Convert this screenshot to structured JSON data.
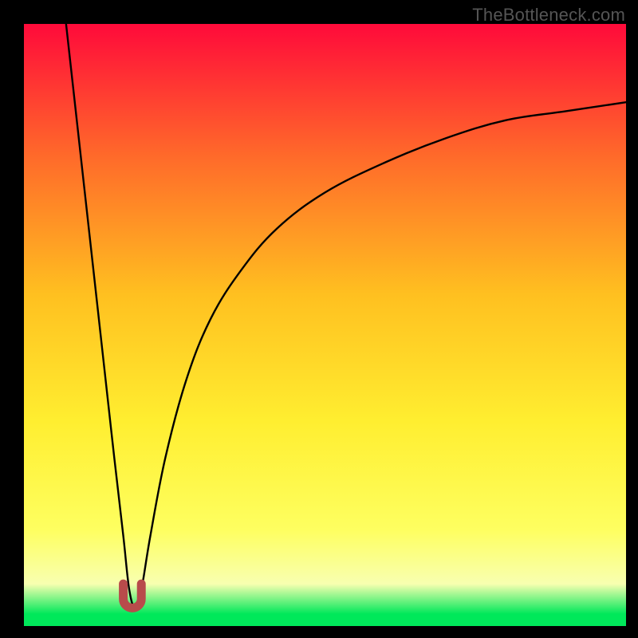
{
  "watermark": "TheBottleneck.com",
  "colors": {
    "gradient_top": "#ff0a3a",
    "gradient_mid_upper": "#ff6a2a",
    "gradient_mid": "#ffc020",
    "gradient_mid_lower": "#ffee30",
    "gradient_low": "#feff60",
    "gradient_band": "#f8ffb0",
    "gradient_bottom": "#00e85a",
    "curve": "#000000",
    "tip_fill": "#b84b4b",
    "frame": "#000000"
  },
  "chart_data": {
    "type": "line",
    "title": "",
    "xlabel": "",
    "ylabel": "",
    "xlim": [
      0,
      100
    ],
    "ylim": [
      0,
      100
    ],
    "note": "Axes unlabeled; values read from pixel geometry as percentages of plot area. Describes a V-shaped bottleneck curve with minimum near x≈18. Left branch nearly linear from (7,100)→(18,3). Right branch rises steeply then decelerates toward (100,87). Red U-shaped tip marker at curve minimum.",
    "series": [
      {
        "name": "bottleneck-curve",
        "x": [
          7,
          10,
          13,
          15,
          16.5,
          17.5,
          18.5,
          19.5,
          21,
          23.5,
          27,
          31,
          36,
          42,
          50,
          60,
          70,
          80,
          90,
          100
        ],
        "y": [
          100,
          73,
          46,
          28,
          15,
          6,
          3,
          6,
          15,
          28,
          41,
          51,
          59,
          66,
          72,
          77,
          81,
          84,
          85.5,
          87
        ]
      }
    ],
    "marker": {
      "name": "curve-tip",
      "shape": "U",
      "center_x": 18,
      "y_top": 7,
      "y_bottom": 3,
      "width": 3,
      "color": "#b84b4b"
    }
  }
}
